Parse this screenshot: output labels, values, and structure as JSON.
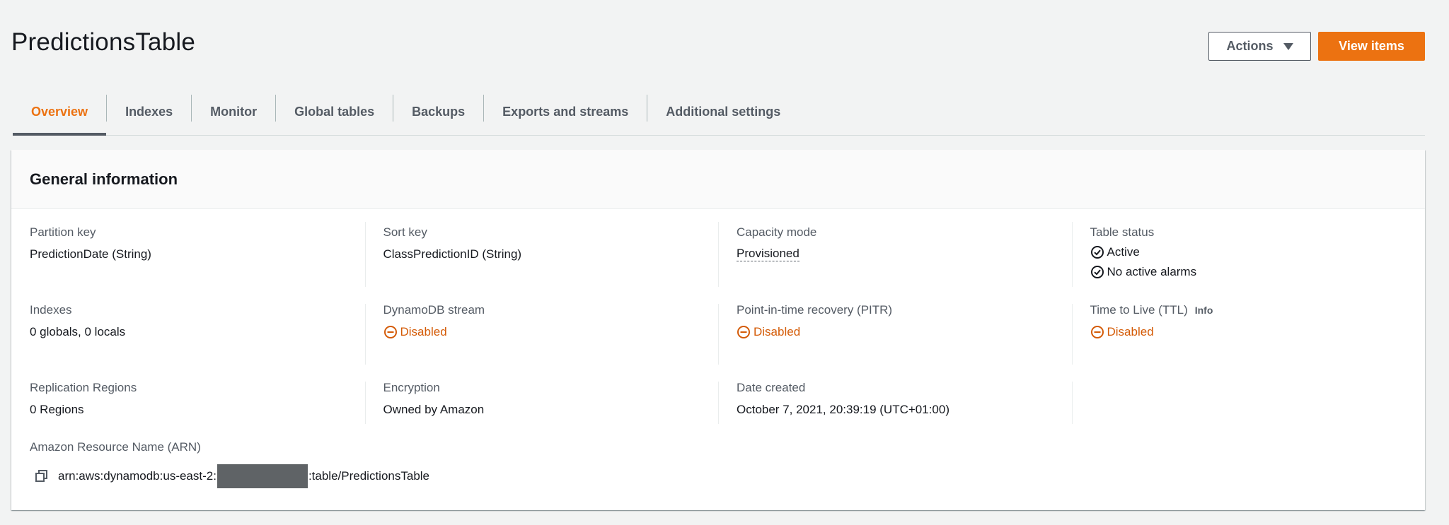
{
  "header": {
    "title": "PredictionsTable",
    "actions_label": "Actions",
    "view_items_label": "View items"
  },
  "tabs": [
    {
      "label": "Overview",
      "active": true
    },
    {
      "label": "Indexes"
    },
    {
      "label": "Monitor"
    },
    {
      "label": "Global tables"
    },
    {
      "label": "Backups"
    },
    {
      "label": "Exports and streams"
    },
    {
      "label": "Additional settings"
    }
  ],
  "general": {
    "title": "General information",
    "partition_key": {
      "label": "Partition key",
      "value": "PredictionDate (String)"
    },
    "sort_key": {
      "label": "Sort key",
      "value": "ClassPredictionID (String)"
    },
    "capacity_mode": {
      "label": "Capacity mode",
      "value": "Provisioned"
    },
    "table_status": {
      "label": "Table status",
      "status": "Active",
      "alarms": "No active alarms"
    },
    "indexes": {
      "label": "Indexes",
      "value": "0 globals, 0 locals"
    },
    "dynamodb_stream": {
      "label": "DynamoDB stream",
      "value": "Disabled"
    },
    "pitr": {
      "label": "Point-in-time recovery (PITR)",
      "value": "Disabled"
    },
    "ttl": {
      "label": "Time to Live (TTL)",
      "info": "Info",
      "value": "Disabled"
    },
    "replication": {
      "label": "Replication Regions",
      "value": "0 Regions"
    },
    "encryption": {
      "label": "Encryption",
      "value": "Owned by Amazon"
    },
    "date_created": {
      "label": "Date created",
      "value": "October 7, 2021, 20:39:19 (UTC+01:00)"
    },
    "arn": {
      "label": "Amazon Resource Name (ARN)",
      "prefix": "arn:aws:dynamodb:us-east-2:",
      "suffix": ":table/PredictionsTable"
    }
  },
  "colors": {
    "accent": "#ec7211",
    "warning": "#d45b07",
    "text": "#16191f",
    "muted": "#545b64"
  }
}
